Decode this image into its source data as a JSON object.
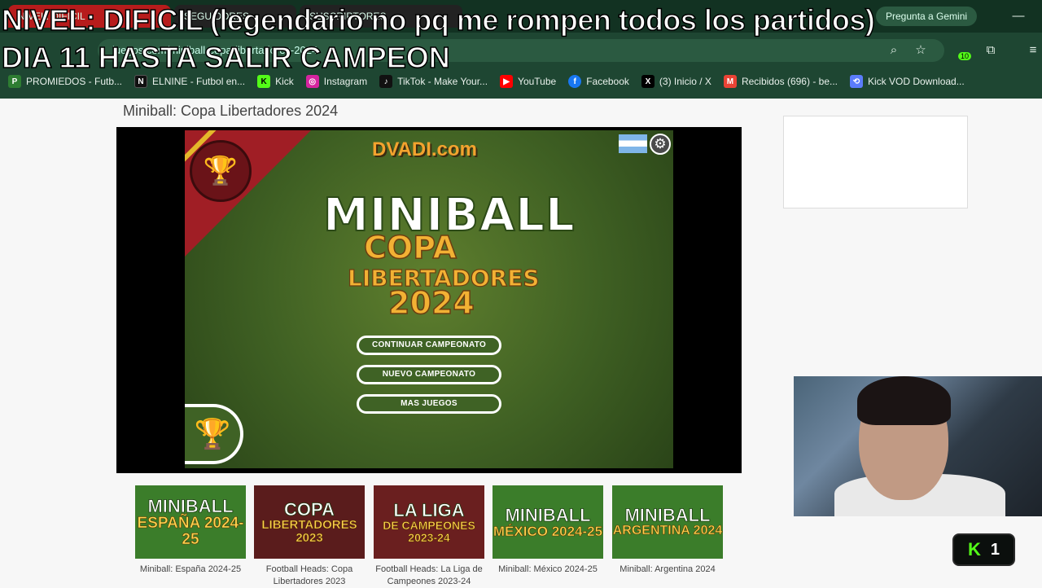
{
  "browser": {
    "tabs": [
      {
        "label": "NIVEL: DIFICIL"
      },
      {
        "label": "SEGUIDORES"
      },
      {
        "label": "SUSCRIPTORES"
      }
    ],
    "gemini_label": "Pregunta a Gemini",
    "url": "juegos.com/miniball-copa-libertadores-2024",
    "extensions_badge": "10",
    "bookmarks": [
      {
        "label": "PROMIEDOS - Futb...",
        "icon": "promiedos-icon",
        "color": "#2e7d32"
      },
      {
        "label": "ELNINE - Futbol en...",
        "icon": "elnine-icon",
        "color": "#111111"
      },
      {
        "label": "Kick",
        "icon": "kick-icon",
        "color": "#53fc18"
      },
      {
        "label": "Instagram",
        "icon": "instagram-icon",
        "color": "#d6249f"
      },
      {
        "label": "TikTok - Make Your...",
        "icon": "tiktok-icon",
        "color": "#111111"
      },
      {
        "label": "YouTube",
        "icon": "youtube-icon",
        "color": "#ff0000"
      },
      {
        "label": "Facebook",
        "icon": "facebook-icon",
        "color": "#1877f2"
      },
      {
        "label": "(3) Inicio / X",
        "icon": "x-icon",
        "color": "#000000"
      },
      {
        "label": "Recibidos (696) - be...",
        "icon": "gmail-icon",
        "color": "#ea4335"
      },
      {
        "label": "Kick VOD Download...",
        "icon": "kickvod-icon",
        "color": "#5b7cfa"
      }
    ]
  },
  "stream_overlay": {
    "line1": "NIVEL: DIFICIL (legendario no pq me rompen todos los partidos)",
    "line2": "DIA 11 HASTA SALIR CAMPEON"
  },
  "page": {
    "title": "Miniball: Copa Libertadores 2024"
  },
  "game": {
    "logo": "DVADI.com",
    "title_line1": "MINIBALL",
    "title_line2": "COPA",
    "title_line3": "LIBERTADORES",
    "title_line4": "2024",
    "buttons": {
      "continue": "CONTINUAR CAMPEONATO",
      "new": "NUEVO CAMPEONATO",
      "more": "MAS JUEGOS"
    }
  },
  "related_games": [
    {
      "thumb_top": "MINIBALL",
      "thumb_bottom": "ESPAÑA 2024-25",
      "caption": "Miniball: España 2024-25",
      "bg": "#3b7d2a"
    },
    {
      "thumb_top": "COPA",
      "thumb_bottom": "LIBERTADORES 2023",
      "caption": "Football Heads: Copa Libertadores 2023",
      "bg": "#5a1c1c"
    },
    {
      "thumb_top": "LA LIGA",
      "thumb_bottom": "DE CAMPEONES 2023-24",
      "caption": "Football Heads: La Liga de Campeones 2023-24",
      "bg": "#6a1f1f"
    },
    {
      "thumb_top": "MINIBALL",
      "thumb_bottom": "MÉXICO 2024-25",
      "caption": "Miniball: México 2024-25",
      "bg": "#3b7d2a"
    },
    {
      "thumb_top": "MINIBALL",
      "thumb_bottom": "ARGENTINA 2024",
      "caption": "Miniball: Argentina 2024",
      "bg": "#3b7d2a"
    }
  ],
  "kick_widget": {
    "logo": "K",
    "viewers": "1"
  }
}
